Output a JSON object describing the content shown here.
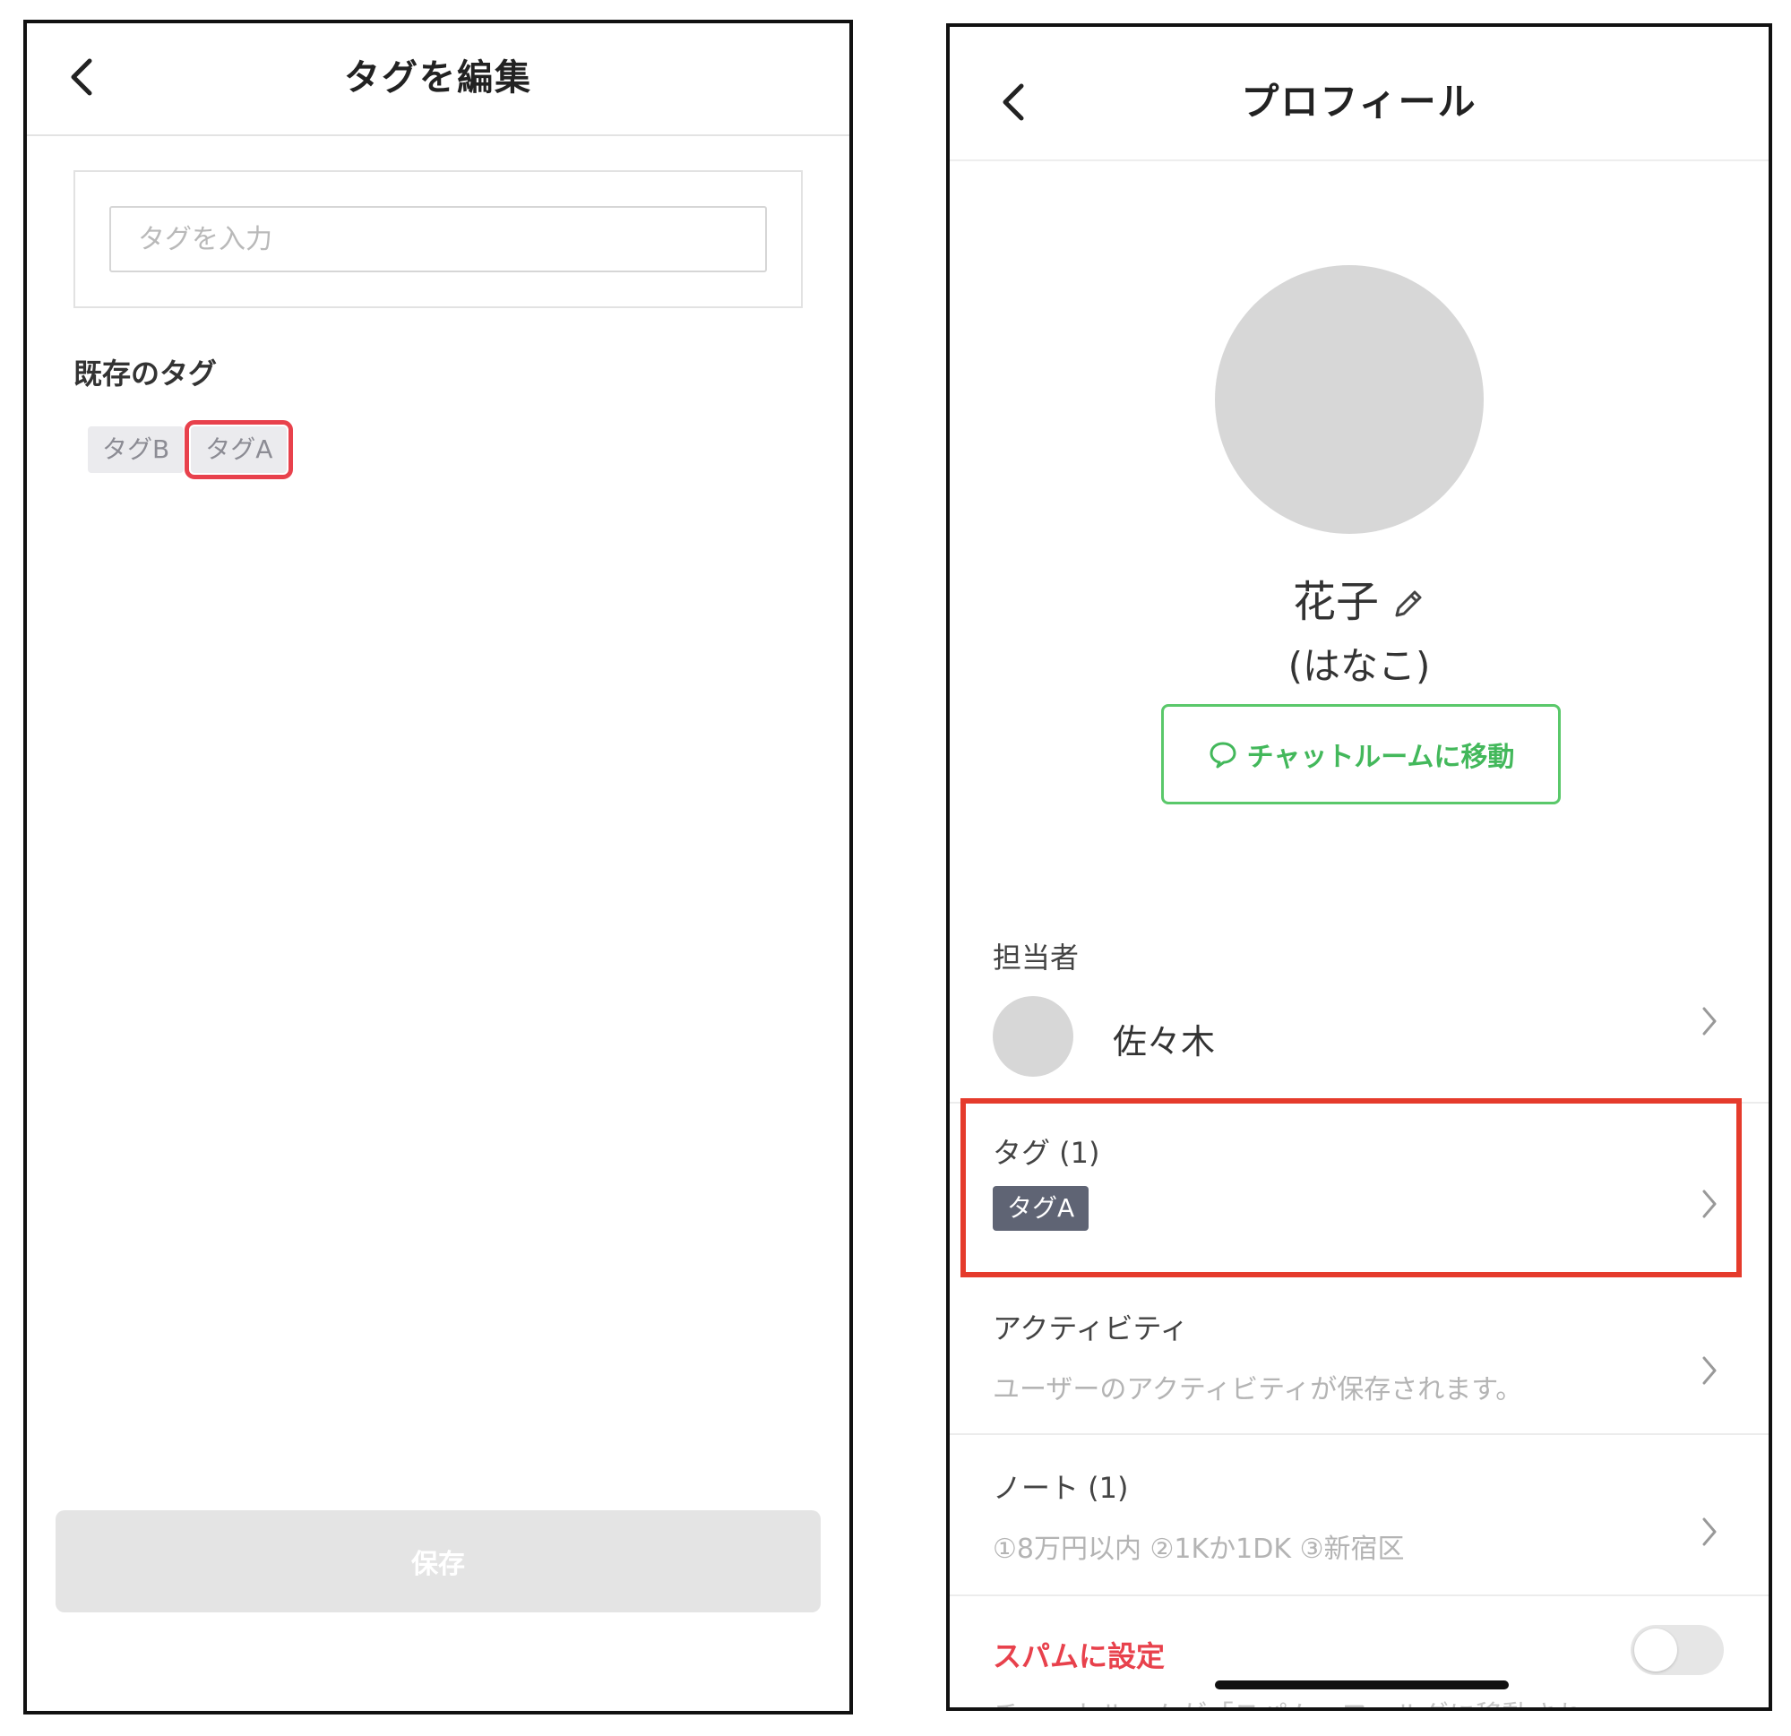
{
  "tag_editor": {
    "title": "タグを編集",
    "input_placeholder": "タグを入力",
    "existing_tags_label": "既存のタグ",
    "existing_tags": [
      "タグB",
      "タグA"
    ],
    "selected_tag": "タグA",
    "save_label": "保存"
  },
  "profile": {
    "title": "プロフィール",
    "name": "花子",
    "name_kana": "(はなこ)",
    "chat_button_label": "チャットルームに移動",
    "assignee_label": "担当者",
    "assignee_name": "佐々木",
    "tags_label": "タグ (1)",
    "tags": [
      "タグA"
    ],
    "activity_label": "アクティビティ",
    "activity_sub": "ユーザーのアクティビティが保存されます。",
    "notes_label": "ノート (1)",
    "notes_sub": "①8万円以内 ②1Kか1DK ③新宿区",
    "spam_label": "スパムに設定",
    "spam_enabled": false,
    "spam_sub": "チャットルームが「スパム」フォルダに移動され"
  },
  "colors": {
    "accent_green": "#43b85b",
    "highlight_red": "#e53b2c",
    "spam_red": "#e8414c",
    "tag_pill_bg": "#5f6474",
    "chip_bg": "#ebebee"
  },
  "icons": [
    "back-chevron-icon",
    "pencil-icon",
    "chat-bubble-icon",
    "chevron-right-icon"
  ]
}
